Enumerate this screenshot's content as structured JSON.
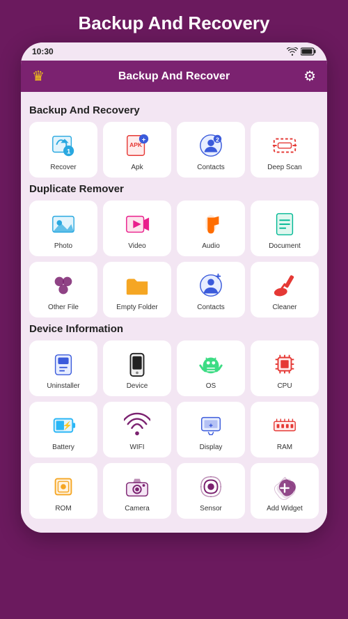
{
  "page": {
    "title": "Backup And Recovery"
  },
  "statusBar": {
    "time": "10:30"
  },
  "header": {
    "title": "Backup And Recover"
  },
  "sections": [
    {
      "title": "Backup And Recovery",
      "items": [
        {
          "id": "recover",
          "label": "Recover",
          "icon": "recover"
        },
        {
          "id": "apk",
          "label": "Apk",
          "icon": "apk"
        },
        {
          "id": "contacts",
          "label": "Contacts",
          "icon": "contacts-blue"
        },
        {
          "id": "deepscan",
          "label": "Deep Scan",
          "icon": "deepscan"
        }
      ]
    },
    {
      "title": "Duplicate Remover",
      "items": [
        {
          "id": "photo",
          "label": "Photo",
          "icon": "photo"
        },
        {
          "id": "video",
          "label": "Video",
          "icon": "video"
        },
        {
          "id": "audio",
          "label": "Audio",
          "icon": "audio"
        },
        {
          "id": "document",
          "label": "Document",
          "icon": "document"
        },
        {
          "id": "otherfile",
          "label": "Other File",
          "icon": "otherfile"
        },
        {
          "id": "emptyfolder",
          "label": "Empty Folder",
          "icon": "emptyfolder"
        },
        {
          "id": "contacts-dup",
          "label": "Contacts",
          "icon": "contacts-dup"
        },
        {
          "id": "cleaner",
          "label": "Cleaner",
          "icon": "cleaner"
        }
      ]
    },
    {
      "title": "Device Information",
      "items": [
        {
          "id": "uninstaller",
          "label": "Uninstaller",
          "icon": "uninstaller"
        },
        {
          "id": "device",
          "label": "Device",
          "icon": "device"
        },
        {
          "id": "os",
          "label": "OS",
          "icon": "os"
        },
        {
          "id": "cpu",
          "label": "CPU",
          "icon": "cpu"
        },
        {
          "id": "battery",
          "label": "Battery",
          "icon": "battery"
        },
        {
          "id": "wifi",
          "label": "WIFI",
          "icon": "wifi"
        },
        {
          "id": "display",
          "label": "Display",
          "icon": "display"
        },
        {
          "id": "ram",
          "label": "RAM",
          "icon": "ram"
        },
        {
          "id": "rom",
          "label": "ROM",
          "icon": "rom"
        },
        {
          "id": "camera",
          "label": "Camera",
          "icon": "camera"
        },
        {
          "id": "sensor",
          "label": "Sensor",
          "icon": "sensor"
        },
        {
          "id": "addwidget",
          "label": "Add Widget",
          "icon": "addwidget"
        }
      ]
    }
  ]
}
